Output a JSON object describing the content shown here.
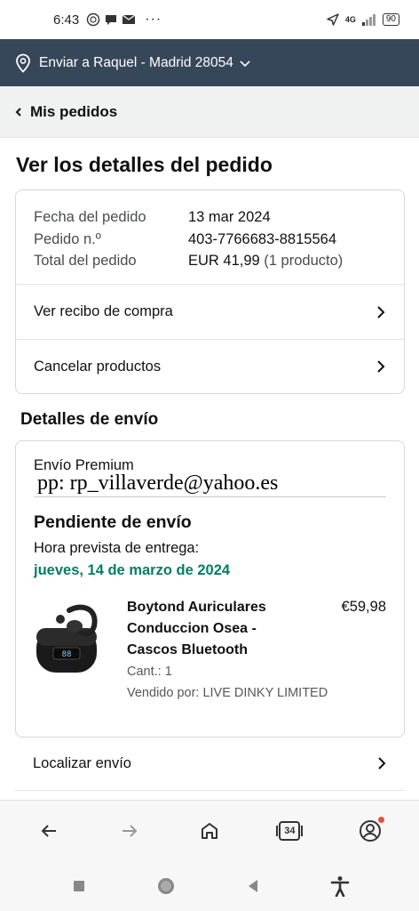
{
  "status_bar": {
    "time": "6:43",
    "network": "4G",
    "battery": "90"
  },
  "location": {
    "label": "Enviar a Raquel - Madrid 28054"
  },
  "breadcrumb": {
    "back_label": "Mis pedidos"
  },
  "page": {
    "title": "Ver los detalles del pedido"
  },
  "order": {
    "fields": [
      {
        "label": "Fecha del pedido",
        "value": "13 mar 2024",
        "suffix": ""
      },
      {
        "label": "Pedido n.º",
        "value": "403-7766683-8815564",
        "suffix": ""
      },
      {
        "label": "Total del pedido",
        "value": "EUR 41,99",
        "suffix": " (1 producto)"
      }
    ],
    "links": [
      "Ver recibo de compra",
      "Cancelar productos"
    ]
  },
  "shipping": {
    "section_title": "Detalles de envío",
    "type": "Envío Premium",
    "watermark": "pp: rp_villaverde@yahoo.es",
    "status": "Pendiente de envío",
    "eta_label": "Hora prevista de entrega:",
    "eta_date": "jueves, 14 de marzo de 2024",
    "eta_color": "#067d62"
  },
  "product": {
    "name": "Boytond Auriculares Conduccion Osea - Cascos Bluetooth",
    "price": "€59,98",
    "quantity": "Cant.: 1",
    "seller": "Vendido por: LIVE DINKY LIMITED",
    "image_display": "88"
  },
  "track": {
    "label": "Localizar envío"
  },
  "browser_nav": {
    "tab_count": "34",
    "icons": [
      "back-arrow-icon",
      "forward-arrow-icon",
      "home-icon",
      "tabs-icon",
      "account-icon"
    ]
  },
  "colors": {
    "header_bg": "#37475a",
    "crumb_bg": "#f0f2f2",
    "accent_green": "#067d62"
  }
}
